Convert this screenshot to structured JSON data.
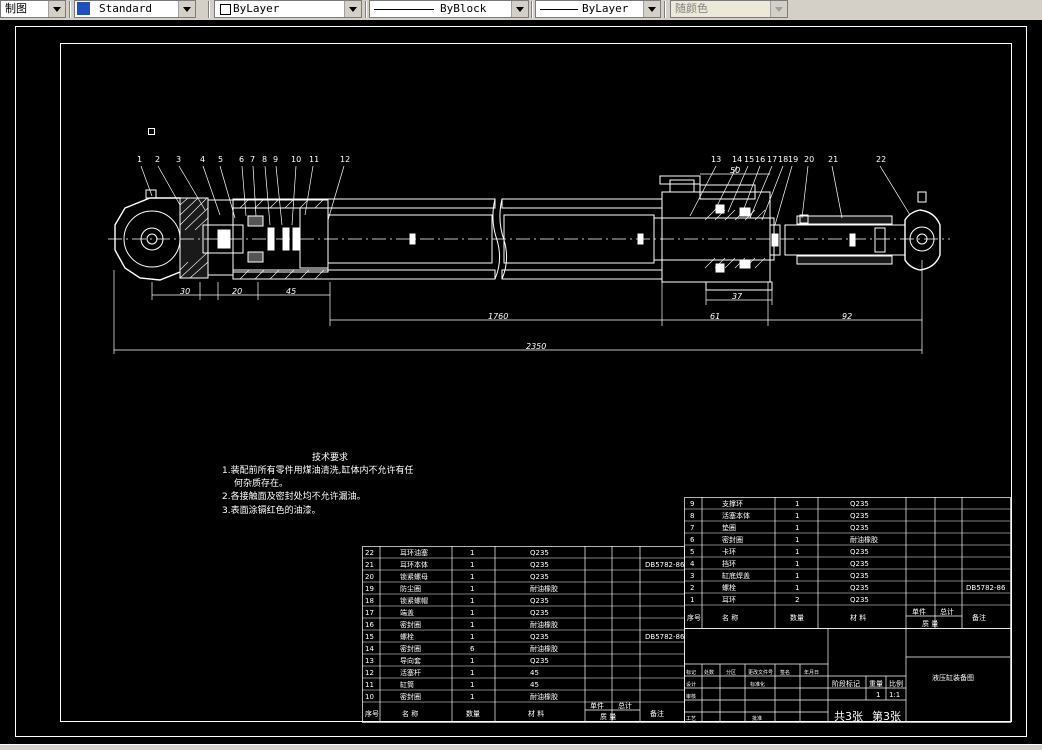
{
  "toolbar": {
    "view_label": "制图",
    "text_style": "Standard",
    "layer": "ByLayer",
    "linetype": "ByBlock",
    "lineweight": "ByLayer",
    "color": "随颜色"
  },
  "drawing": {
    "leaders_left": [
      "1",
      "2",
      "3",
      "4",
      "5",
      "6",
      "7",
      "8",
      "9",
      "10",
      "11",
      "12"
    ],
    "leaders_right": [
      "13",
      "14",
      "15",
      "16",
      "17",
      "18",
      "19",
      "20",
      "21",
      "22"
    ],
    "dim_30": "30",
    "dim_20": "20",
    "dim_45": "45",
    "dim_1760": "1760",
    "dim_61": "61",
    "dim_92": "92",
    "dim_2350": "2350",
    "dim_37": "37",
    "dim_50": "50",
    "tech_req_title": "技术要求",
    "tech_req_1": "1.装配前所有零件用煤油清洗,缸体内不允许有任",
    "tech_req_1b": "何杂质存在。",
    "tech_req_2": "2.各接触面及密封处均不允许漏油。",
    "tech_req_3": "3.表面涂镉红色的油漆。"
  },
  "bom_left": {
    "rows": [
      {
        "no": "22",
        "name": "耳环油塞",
        "qty": "1",
        "mat": "Q235",
        "std": ""
      },
      {
        "no": "21",
        "name": "耳环本体",
        "qty": "1",
        "mat": "Q235",
        "std": "DB5782-86"
      },
      {
        "no": "20",
        "name": "锁紧螺母",
        "qty": "1",
        "mat": "Q235",
        "std": ""
      },
      {
        "no": "19",
        "name": "防尘圈",
        "qty": "1",
        "mat": "耐油橡胶",
        "std": ""
      },
      {
        "no": "18",
        "name": "锁紧螺帽",
        "qty": "1",
        "mat": "Q235",
        "std": ""
      },
      {
        "no": "17",
        "name": "端盖",
        "qty": "1",
        "mat": "Q235",
        "std": ""
      },
      {
        "no": "16",
        "name": "密封圈",
        "qty": "1",
        "mat": "耐油橡胶",
        "std": ""
      },
      {
        "no": "15",
        "name": "螺栓",
        "qty": "1",
        "mat": "Q235",
        "std": "DB5782-86"
      },
      {
        "no": "14",
        "name": "密封圈",
        "qty": "6",
        "mat": "耐油橡胶",
        "std": ""
      },
      {
        "no": "13",
        "name": "导向套",
        "qty": "1",
        "mat": "Q235",
        "std": ""
      },
      {
        "no": "12",
        "name": "活塞杆",
        "qty": "1",
        "mat": "45",
        "std": ""
      },
      {
        "no": "11",
        "name": "缸筒",
        "qty": "1",
        "mat": "45",
        "std": ""
      },
      {
        "no": "10",
        "name": "密封圈",
        "qty": "1",
        "mat": "耐油橡胶",
        "std": ""
      }
    ],
    "hdr_no": "序号",
    "hdr_name": "名 称",
    "hdr_qty": "数量",
    "hdr_mat": "材 料",
    "hdr_unit": "单件",
    "hdr_total": "总计",
    "hdr_weight": "质 量",
    "hdr_note": "备注"
  },
  "bom_right": {
    "rows": [
      {
        "no": "9",
        "name": "支撑环",
        "qty": "1",
        "mat": "Q235",
        "std": ""
      },
      {
        "no": "8",
        "name": "活塞本体",
        "qty": "1",
        "mat": "Q235",
        "std": ""
      },
      {
        "no": "7",
        "name": "垫圈",
        "qty": "1",
        "mat": "Q235",
        "std": ""
      },
      {
        "no": "6",
        "name": "密封圈",
        "qty": "1",
        "mat": "耐油橡胶",
        "std": ""
      },
      {
        "no": "5",
        "name": "卡环",
        "qty": "1",
        "mat": "Q235",
        "std": ""
      },
      {
        "no": "4",
        "name": "挡环",
        "qty": "1",
        "mat": "Q235",
        "std": ""
      },
      {
        "no": "3",
        "name": "缸底焊盖",
        "qty": "1",
        "mat": "Q235",
        "std": ""
      },
      {
        "no": "2",
        "name": "螺栓",
        "qty": "1",
        "mat": "Q235",
        "std": "DB5782-86"
      },
      {
        "no": "1",
        "name": "耳环",
        "qty": "2",
        "mat": "Q235",
        "std": ""
      }
    ],
    "hdr_no": "序号",
    "hdr_name": "名 称",
    "hdr_qty": "数量",
    "hdr_mat": "材 料",
    "hdr_unit": "单件",
    "hdr_total": "总计",
    "hdr_weight": "质 量",
    "hdr_note": "备注"
  },
  "title_block": {
    "drawing_title": "液压缸装备图",
    "stage": "阶段标记",
    "weight": "重量",
    "scale_label": "比例",
    "qty": "1",
    "scale": "1:1",
    "sheets": "共3张",
    "sheet_no": "第3张",
    "tag_label": "标记",
    "count_label": "处数",
    "area_label": "分区",
    "change_label": "更改文件号",
    "sign_label": "签名",
    "date_label": "年月日",
    "design_label": "设计",
    "standard_label": "标准化",
    "check_label": "审核",
    "process_label": "工艺",
    "approve_label": "批准"
  }
}
